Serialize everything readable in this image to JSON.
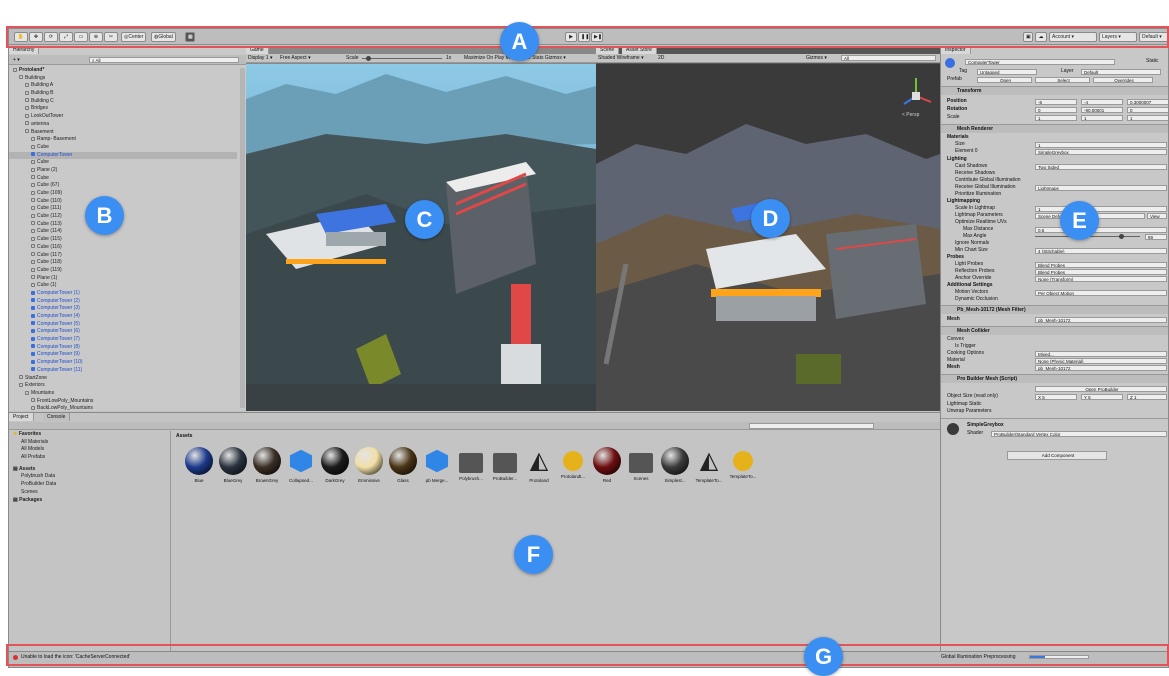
{
  "toolbar": {
    "tool_buttons": [
      "✋",
      "✥",
      "⟳",
      "⤢",
      "▭",
      "⊕",
      "✂"
    ],
    "pivot": "Center",
    "space": "Global",
    "play_icons": [
      "▶",
      "❚❚",
      "▶❚"
    ],
    "right": [
      "☁",
      "Account ▾",
      "Layers ▾",
      "Default ▾"
    ]
  },
  "hierarchy": {
    "tab": "Hierarchy",
    "add": "+ ▾",
    "search_placeholder": "All",
    "rows": [
      {
        "label": "Protoland*",
        "indent": 0,
        "style": "bold"
      },
      {
        "label": "Buildings",
        "indent": 1
      },
      {
        "label": "Building A",
        "indent": 2
      },
      {
        "label": "Building B",
        "indent": 2
      },
      {
        "label": "Building C",
        "indent": 2
      },
      {
        "label": "Bridges",
        "indent": 2
      },
      {
        "label": "LookOutTower",
        "indent": 2
      },
      {
        "label": "antenna",
        "indent": 2
      },
      {
        "label": "Basement",
        "indent": 2
      },
      {
        "label": "Ramp- Basement",
        "indent": 3
      },
      {
        "label": "Cube",
        "indent": 3
      },
      {
        "label": "ComputerTower",
        "indent": 3,
        "style": "sel hl"
      },
      {
        "label": "Cube",
        "indent": 3
      },
      {
        "label": "Plane (2)",
        "indent": 3
      },
      {
        "label": "Cube",
        "indent": 3
      },
      {
        "label": "Cube (67)",
        "indent": 3
      },
      {
        "label": "Cube (109)",
        "indent": 3
      },
      {
        "label": "Cube (110)",
        "indent": 3
      },
      {
        "label": "Cube (111)",
        "indent": 3
      },
      {
        "label": "Cube (112)",
        "indent": 3
      },
      {
        "label": "Cube (113)",
        "indent": 3
      },
      {
        "label": "Cube (114)",
        "indent": 3
      },
      {
        "label": "Cube (115)",
        "indent": 3
      },
      {
        "label": "Cube (116)",
        "indent": 3
      },
      {
        "label": "Cube (117)",
        "indent": 3
      },
      {
        "label": "Cube (118)",
        "indent": 3
      },
      {
        "label": "Cube (119)",
        "indent": 3
      },
      {
        "label": "Plane (1)",
        "indent": 3
      },
      {
        "label": "Cube (1)",
        "indent": 3
      },
      {
        "label": "ComputerTower (1)",
        "indent": 3,
        "style": "sel"
      },
      {
        "label": "ComputerTower (2)",
        "indent": 3,
        "style": "sel"
      },
      {
        "label": "ComputerTower (3)",
        "indent": 3,
        "style": "sel"
      },
      {
        "label": "ComputerTower (4)",
        "indent": 3,
        "style": "sel"
      },
      {
        "label": "ComputerTower (5)",
        "indent": 3,
        "style": "sel"
      },
      {
        "label": "ComputerTower (6)",
        "indent": 3,
        "style": "sel"
      },
      {
        "label": "ComputerTower (7)",
        "indent": 3,
        "style": "sel"
      },
      {
        "label": "ComputerTower (8)",
        "indent": 3,
        "style": "sel"
      },
      {
        "label": "ComputerTower (9)",
        "indent": 3,
        "style": "sel"
      },
      {
        "label": "ComputerTower (10)",
        "indent": 3,
        "style": "sel"
      },
      {
        "label": "ComputerTower (11)",
        "indent": 3,
        "style": "sel"
      },
      {
        "label": "StartZone",
        "indent": 1
      },
      {
        "label": "Exteriors",
        "indent": 1
      },
      {
        "label": "Mountains",
        "indent": 2
      },
      {
        "label": "FrontLowPoly_Mountains",
        "indent": 3
      },
      {
        "label": "BackLowPoly_Mountains",
        "indent": 3
      },
      {
        "label": "LowpolyMountain_Fixed",
        "indent": 4
      },
      {
        "label": "LowpolyMountain_Fixed (1)",
        "indent": 4
      },
      {
        "label": "LowpolyMountain_Fixed (2)",
        "indent": 4
      }
    ]
  },
  "game_view": {
    "tab": "Game",
    "display": "Display 1 ▾",
    "aspect": "Free Aspect ▾",
    "scale_label": "Scale",
    "scale_value": "1x",
    "scale_level": 0.05,
    "right": "Maximize On Play  Mute Audio  Stats  Gizmos ▾"
  },
  "scene_view": {
    "tab": "Scene",
    "tab2": "Asset Store",
    "shading": "Shaded Wireframe ▾",
    "mode": "2D",
    "gizmos": "Gizmos ▾",
    "search": "All",
    "persp": "< Persp"
  },
  "inspector": {
    "tab": "Inspector",
    "object_name": "ComputerTower",
    "static": "Static",
    "tag_label": "Tag",
    "tag": "Untagged",
    "layer_label": "Layer",
    "layer": "Default",
    "prefab_label": "Prefab",
    "prefab_buttons": [
      "Open",
      "Select",
      "Overrides"
    ],
    "transform_title": "Transform",
    "position_label": "Position",
    "position": [
      "-5",
      "-4",
      "0.3000007"
    ],
    "rotation_label": "Rotation",
    "rotation": [
      "0",
      "-90.00001",
      "0"
    ],
    "scale_label": "Scale",
    "scale": [
      "1",
      "1",
      "1"
    ],
    "mesh_renderer_title": "Mesh Renderer",
    "materials": "Materials",
    "size_label": "Size",
    "size": "1",
    "element_label": "Element 0",
    "element": "SimpleGreybox",
    "lighting": "Lighting",
    "cast_shadows_label": "Cast Shadows",
    "cast_shadows": "Two Sided",
    "receive_shadows": "Receive Shadows",
    "contribute_gi": "Contribute Global Illumination",
    "receive_gi": "Receive Global Illumination",
    "receive_gi_value": "Lightmaps",
    "prioritize": "Prioritize Illumination",
    "lightmapping": "Lightmapping",
    "scale_in_lightmap_label": "Scale In Lightmap",
    "scale_in_lightmap": "1",
    "lightmap_params_label": "Lightmap Parameters",
    "lightmap_params": "Scene Default Parameters",
    "view": "View",
    "optimize_uvs": "Optimize Realtime UVs",
    "max_distance_label": "Max Distance",
    "max_distance": "0.5",
    "max_angle_label": "Max Angle",
    "max_angle": "89",
    "max_angle_level": 0.8,
    "ignore_normals": "Ignore Normals",
    "min_chart_label": "Min Chart Size",
    "min_chart": "4 (Stitchable)",
    "probes": "Probes",
    "light_probes_label": "Light Probes",
    "light_probes": "Blend Probes",
    "reflection_probes_label": "Reflection Probes",
    "reflection_probes": "Blend Probes",
    "anchor_label": "Anchor Override",
    "anchor": "None (Transform)",
    "additional": "Additional Settings",
    "motion_vectors_label": "Motion Vectors",
    "motion_vectors": "Per Object Motion",
    "dynamic_occlusion": "Dynamic Occlusion",
    "mesh_filter_title": "Pb_Mesh-10172 (Mesh Filter)",
    "mesh_label": "Mesh",
    "mesh_value": "pb_Mesh-10172",
    "mesh_collider_title": "Mesh Collider",
    "convex": "Convex",
    "is_trigger": "Is Trigger",
    "cooking_label": "Cooking Options",
    "cooking": "Mixed...",
    "material_label": "Material",
    "material": "None (Physic Material)",
    "collider_mesh": "pb_Mesh-10172",
    "pb_mesh_title": "Pro Builder Mesh (Script)",
    "open_probuilder": "Open ProBuilder",
    "object_size_label": "Object Size (read only)",
    "object_size": [
      "X 5",
      "Y 5",
      "Z 1"
    ],
    "lightmap_static": "Lightmap Static",
    "unwrap": "Unwrap Parameters",
    "material_name": "SimpleGreybox",
    "shader_label": "Shader",
    "shader": "ProBuilder/Standard Vertex Color",
    "add_component": "Add Component"
  },
  "project": {
    "tabs": [
      "Project",
      "Console"
    ],
    "favorites": "Favorites",
    "fav_items": [
      "All Materials",
      "All Models",
      "All Prefabs"
    ],
    "assets_root": "Assets",
    "asset_folders": [
      "Polybrush Data",
      "ProBuilder Data",
      "Scenes"
    ],
    "packages": "Packages",
    "assets_header": "Assets",
    "assets": [
      {
        "name": "Blue",
        "type": "sphere",
        "color": "#1d3a8c"
      },
      {
        "name": "BlueGrey",
        "type": "sphere",
        "color": "#2b3340"
      },
      {
        "name": "BrownGrey",
        "type": "sphere",
        "color": "#3a2f26"
      },
      {
        "name": "Collapsed...",
        "type": "cube",
        "color": "#2f86e6"
      },
      {
        "name": "DarkGrey",
        "type": "sphere",
        "color": "#1b1b1b"
      },
      {
        "name": "Emmissive",
        "type": "sphere",
        "color": "#f1dfa6"
      },
      {
        "name": "Glass",
        "type": "sphere",
        "color": "#4a3515"
      },
      {
        "name": "pb Merge...",
        "type": "cube",
        "color": "#2f86e6"
      },
      {
        "name": "Polybrush...",
        "type": "folder",
        "color": "#555555"
      },
      {
        "name": "ProBuilder...",
        "type": "folder",
        "color": "#555555"
      },
      {
        "name": "Protoland",
        "type": "unity",
        "color": "#222222"
      },
      {
        "name": "Protolandt...",
        "type": "light",
        "color": "#e6b21c"
      },
      {
        "name": "Red",
        "type": "sphere",
        "color": "#6e0f0f"
      },
      {
        "name": "Scenes",
        "type": "folder",
        "color": "#555555"
      },
      {
        "name": "Simplest...",
        "type": "sphere",
        "color": "#3b3b3b"
      },
      {
        "name": "TemplateTo...",
        "type": "unity",
        "color": "#222222"
      },
      {
        "name": "TemplateTo...",
        "type": "light",
        "color": "#e6b21c"
      }
    ]
  },
  "status": {
    "error": "Unable to load the icon: 'CacheServerConnected'",
    "right": "Global Illumination Preprocessing",
    "progress_level": 0.25
  },
  "callouts": [
    "A",
    "B",
    "C",
    "D",
    "E",
    "F",
    "G"
  ],
  "colors": {
    "callout": "#3b8ef2",
    "highlight": "#e2545a"
  }
}
